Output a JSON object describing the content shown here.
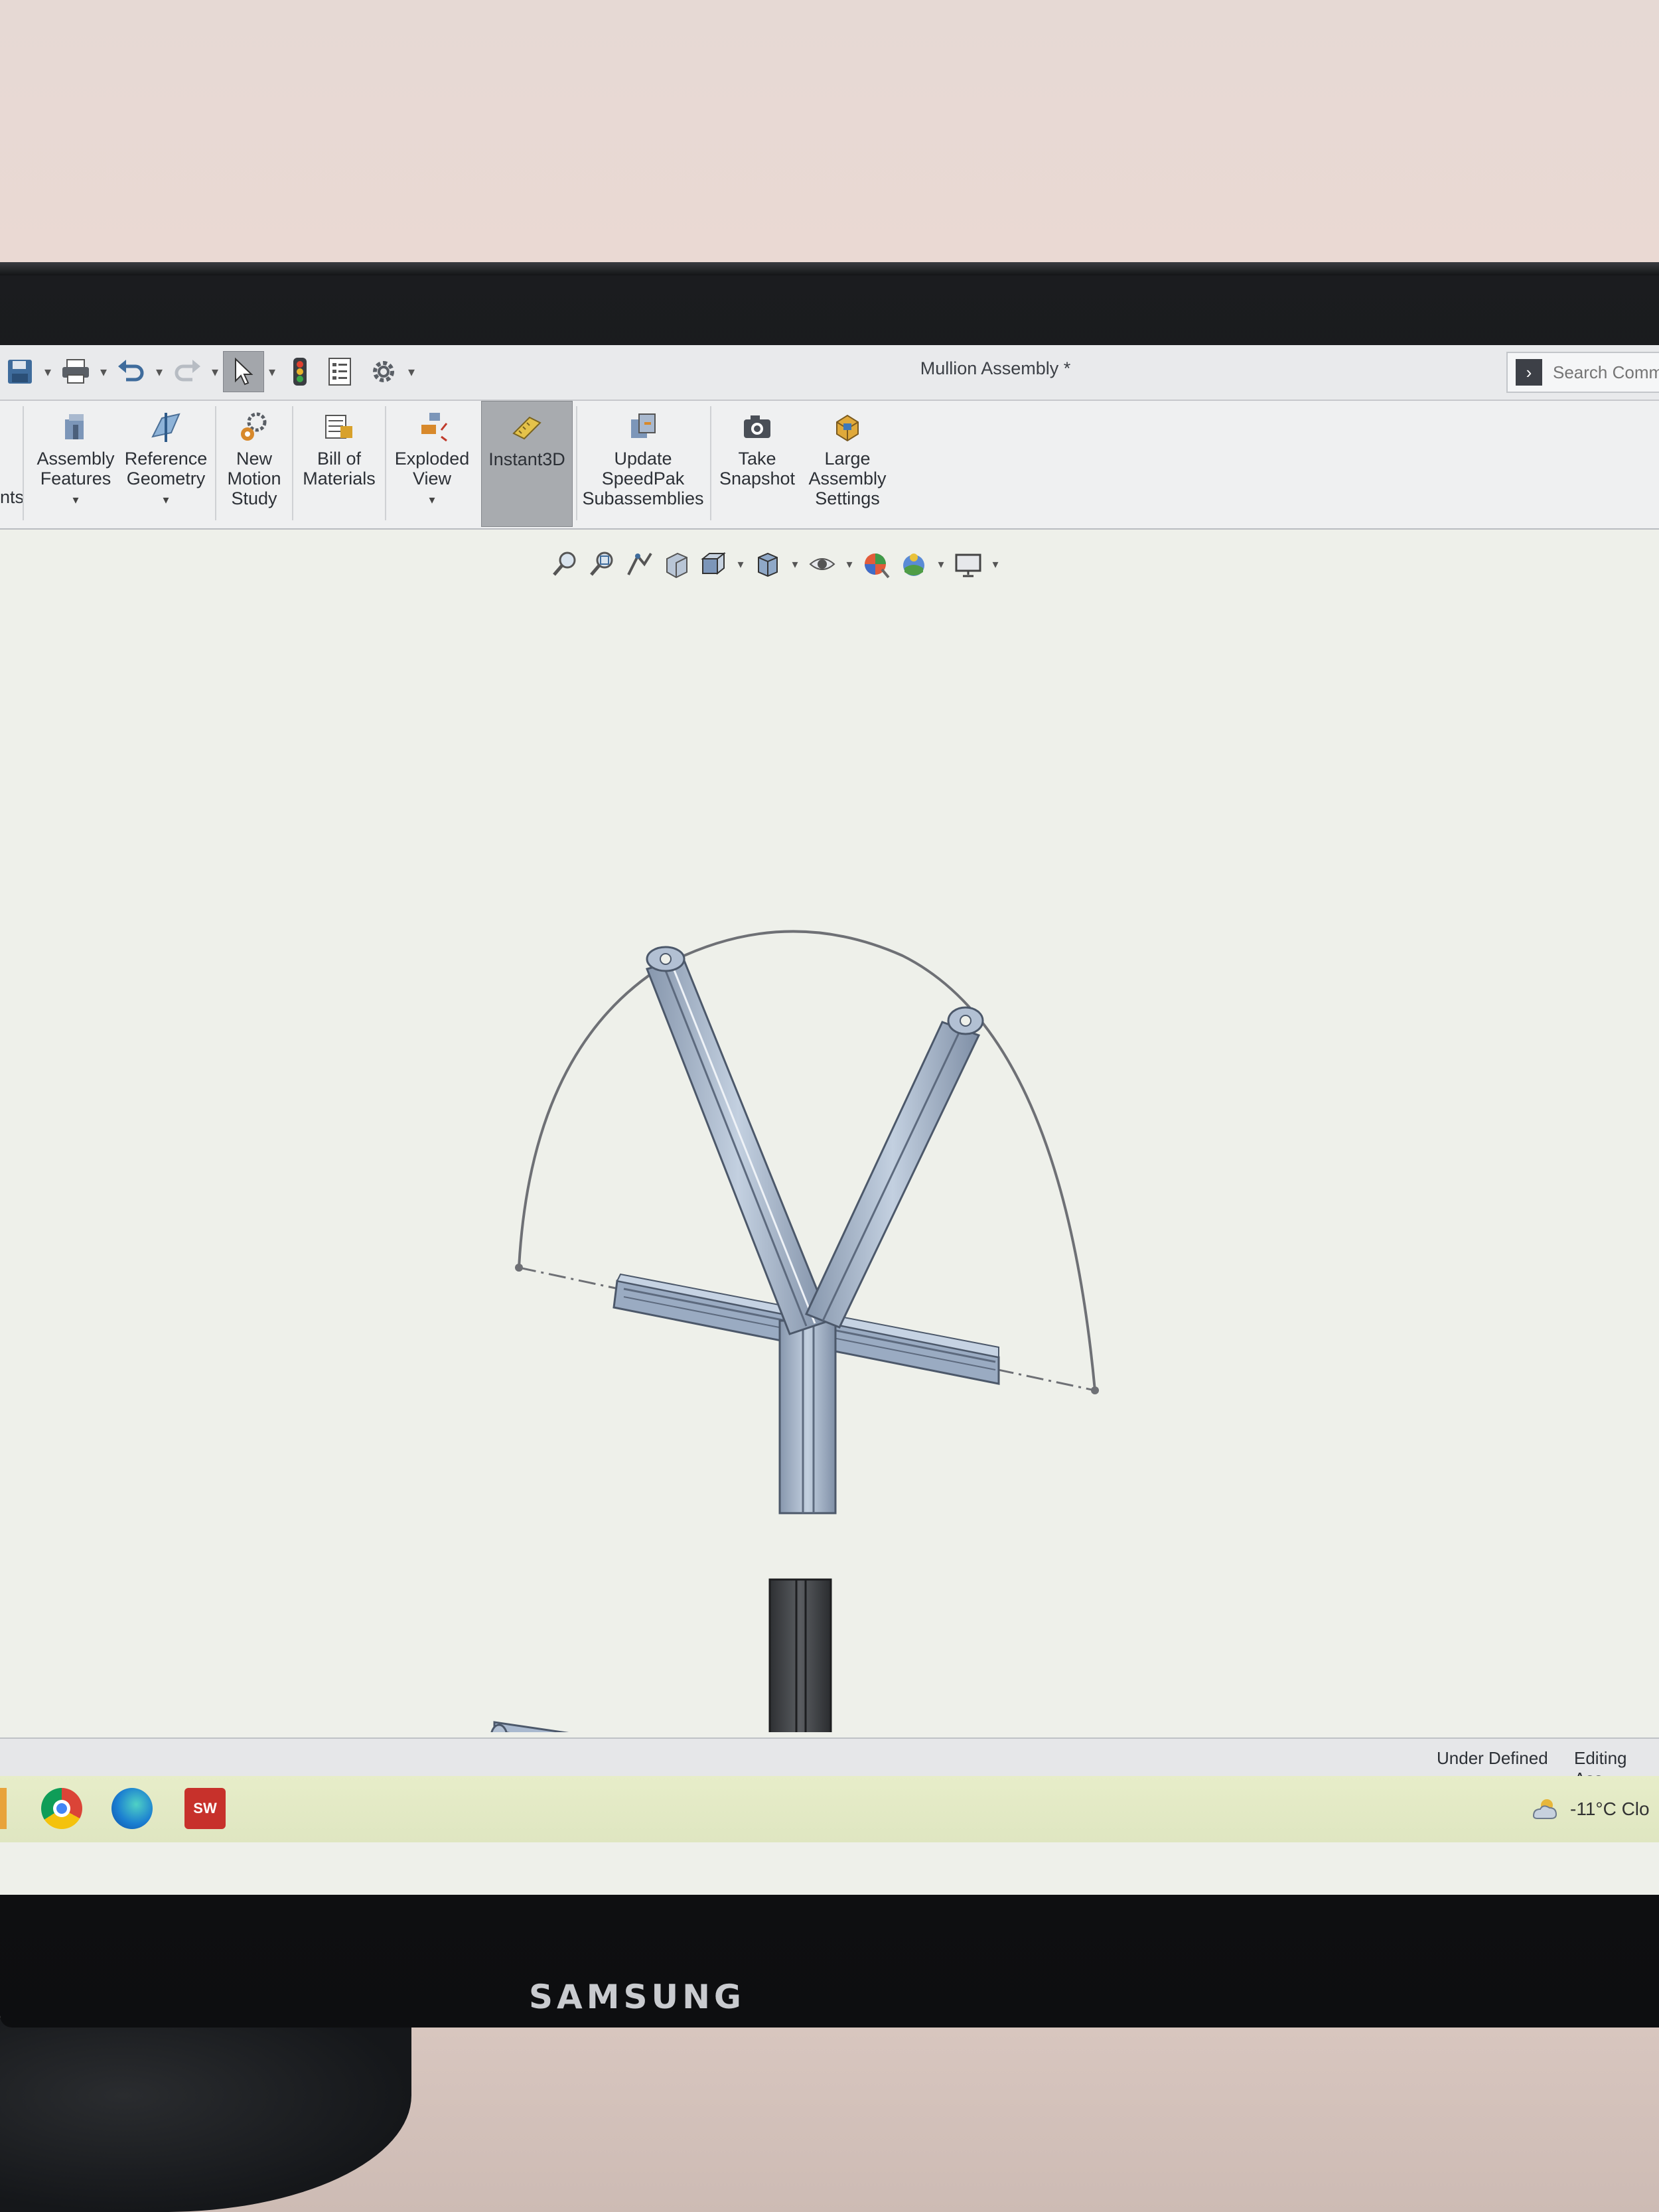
{
  "window": {
    "title": "Mullion Assembly *",
    "search_placeholder": "Search Comma"
  },
  "ribbon": {
    "cut_tab_fragment": "nts",
    "items": [
      {
        "label_1": "Assembly",
        "label_2": "Features",
        "label_3": ""
      },
      {
        "label_1": "Reference",
        "label_2": "Geometry",
        "label_3": ""
      },
      {
        "label_1": "New",
        "label_2": "Motion",
        "label_3": "Study"
      },
      {
        "label_1": "Bill of",
        "label_2": "Materials",
        "label_3": ""
      },
      {
        "label_1": "Exploded",
        "label_2": "View",
        "label_3": ""
      },
      {
        "label_1": "Instant3D",
        "label_2": "",
        "label_3": ""
      },
      {
        "label_1": "Update",
        "label_2": "SpeedPak",
        "label_3": "Subassemblies"
      },
      {
        "label_1": "Take",
        "label_2": "Snapshot",
        "label_3": ""
      },
      {
        "label_1": "Large",
        "label_2": "Assembly",
        "label_3": "Settings"
      }
    ]
  },
  "status": {
    "definition": "Under Defined",
    "mode": "Editing Ass"
  },
  "taskbar": {
    "weather": "-11°C  Clo"
  },
  "brand": "SAMSUNG",
  "colors": {
    "ribbon_bg": "#eff0f1",
    "viewport_bg": "#eef0ea",
    "part_blue": "#a9b9cf",
    "part_dark": "#4a4d50",
    "taskbar_bg": "#e3e9c4"
  }
}
